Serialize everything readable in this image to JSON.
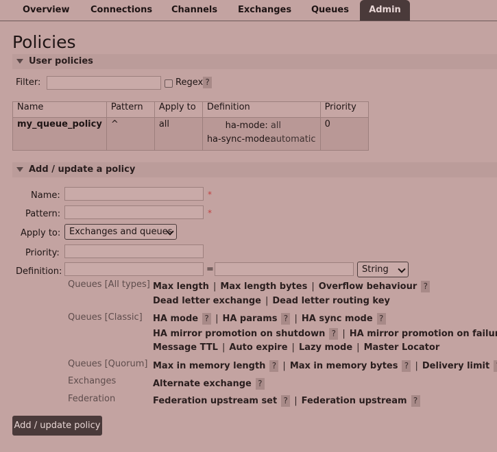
{
  "nav": {
    "tabs": [
      {
        "label": "Overview"
      },
      {
        "label": "Connections"
      },
      {
        "label": "Channels"
      },
      {
        "label": "Exchanges"
      },
      {
        "label": "Queues"
      },
      {
        "label": "Admin",
        "active": true
      }
    ]
  },
  "page": {
    "title": "Policies"
  },
  "user_policies": {
    "header": "User policies",
    "filter_label": "Filter:",
    "filter_value": "",
    "regex_label": "Regex",
    "regex_checked": false,
    "help": "?",
    "table": {
      "columns": [
        "Name",
        "Pattern",
        "Apply to",
        "Definition",
        "Priority"
      ],
      "rows": [
        {
          "name": "my_queue_policy",
          "pattern": "^",
          "apply_to": "all",
          "definition": [
            {
              "key": "ha-mode:",
              "value": "all"
            },
            {
              "key": "ha-sync-mode:",
              "value": "automatic"
            }
          ],
          "priority": "0"
        }
      ]
    }
  },
  "add_policy": {
    "header": "Add / update a policy",
    "name_label": "Name:",
    "name_value": "",
    "pattern_label": "Pattern:",
    "pattern_value": "",
    "required_mark": "*",
    "apply_to_label": "Apply to:",
    "apply_to_value": "Exchanges and queues",
    "priority_label": "Priority:",
    "priority_value": "",
    "definition_label": "Definition:",
    "definition_key": "",
    "equals": "=",
    "definition_value": "",
    "type_value": "String",
    "help": "?",
    "sep": "|",
    "categories": {
      "queues_all": {
        "label": "Queues [All types]",
        "line1": [
          "Max length",
          "Max length bytes",
          "Overflow behaviour"
        ],
        "line2": [
          "Dead letter exchange",
          "Dead letter routing key"
        ]
      },
      "queues_classic": {
        "label": "Queues [Classic]",
        "line1": [
          "HA mode",
          "HA params",
          "HA sync mode"
        ],
        "line2": [
          "HA mirror promotion on shutdown",
          "HA mirror promotion on failure"
        ],
        "line3": [
          "Message TTL",
          "Auto expire",
          "Lazy mode",
          "Master Locator"
        ]
      },
      "queues_quorum": {
        "label": "Queues [Quorum]",
        "line1": [
          "Max in memory length",
          "Max in memory bytes",
          "Delivery limit"
        ]
      },
      "exchanges": {
        "label": "Exchanges",
        "line1": [
          "Alternate exchange"
        ]
      },
      "federation": {
        "label": "Federation",
        "line1": [
          "Federation upstream set",
          "Federation upstream"
        ]
      }
    },
    "submit_label": "Add / update policy"
  }
}
